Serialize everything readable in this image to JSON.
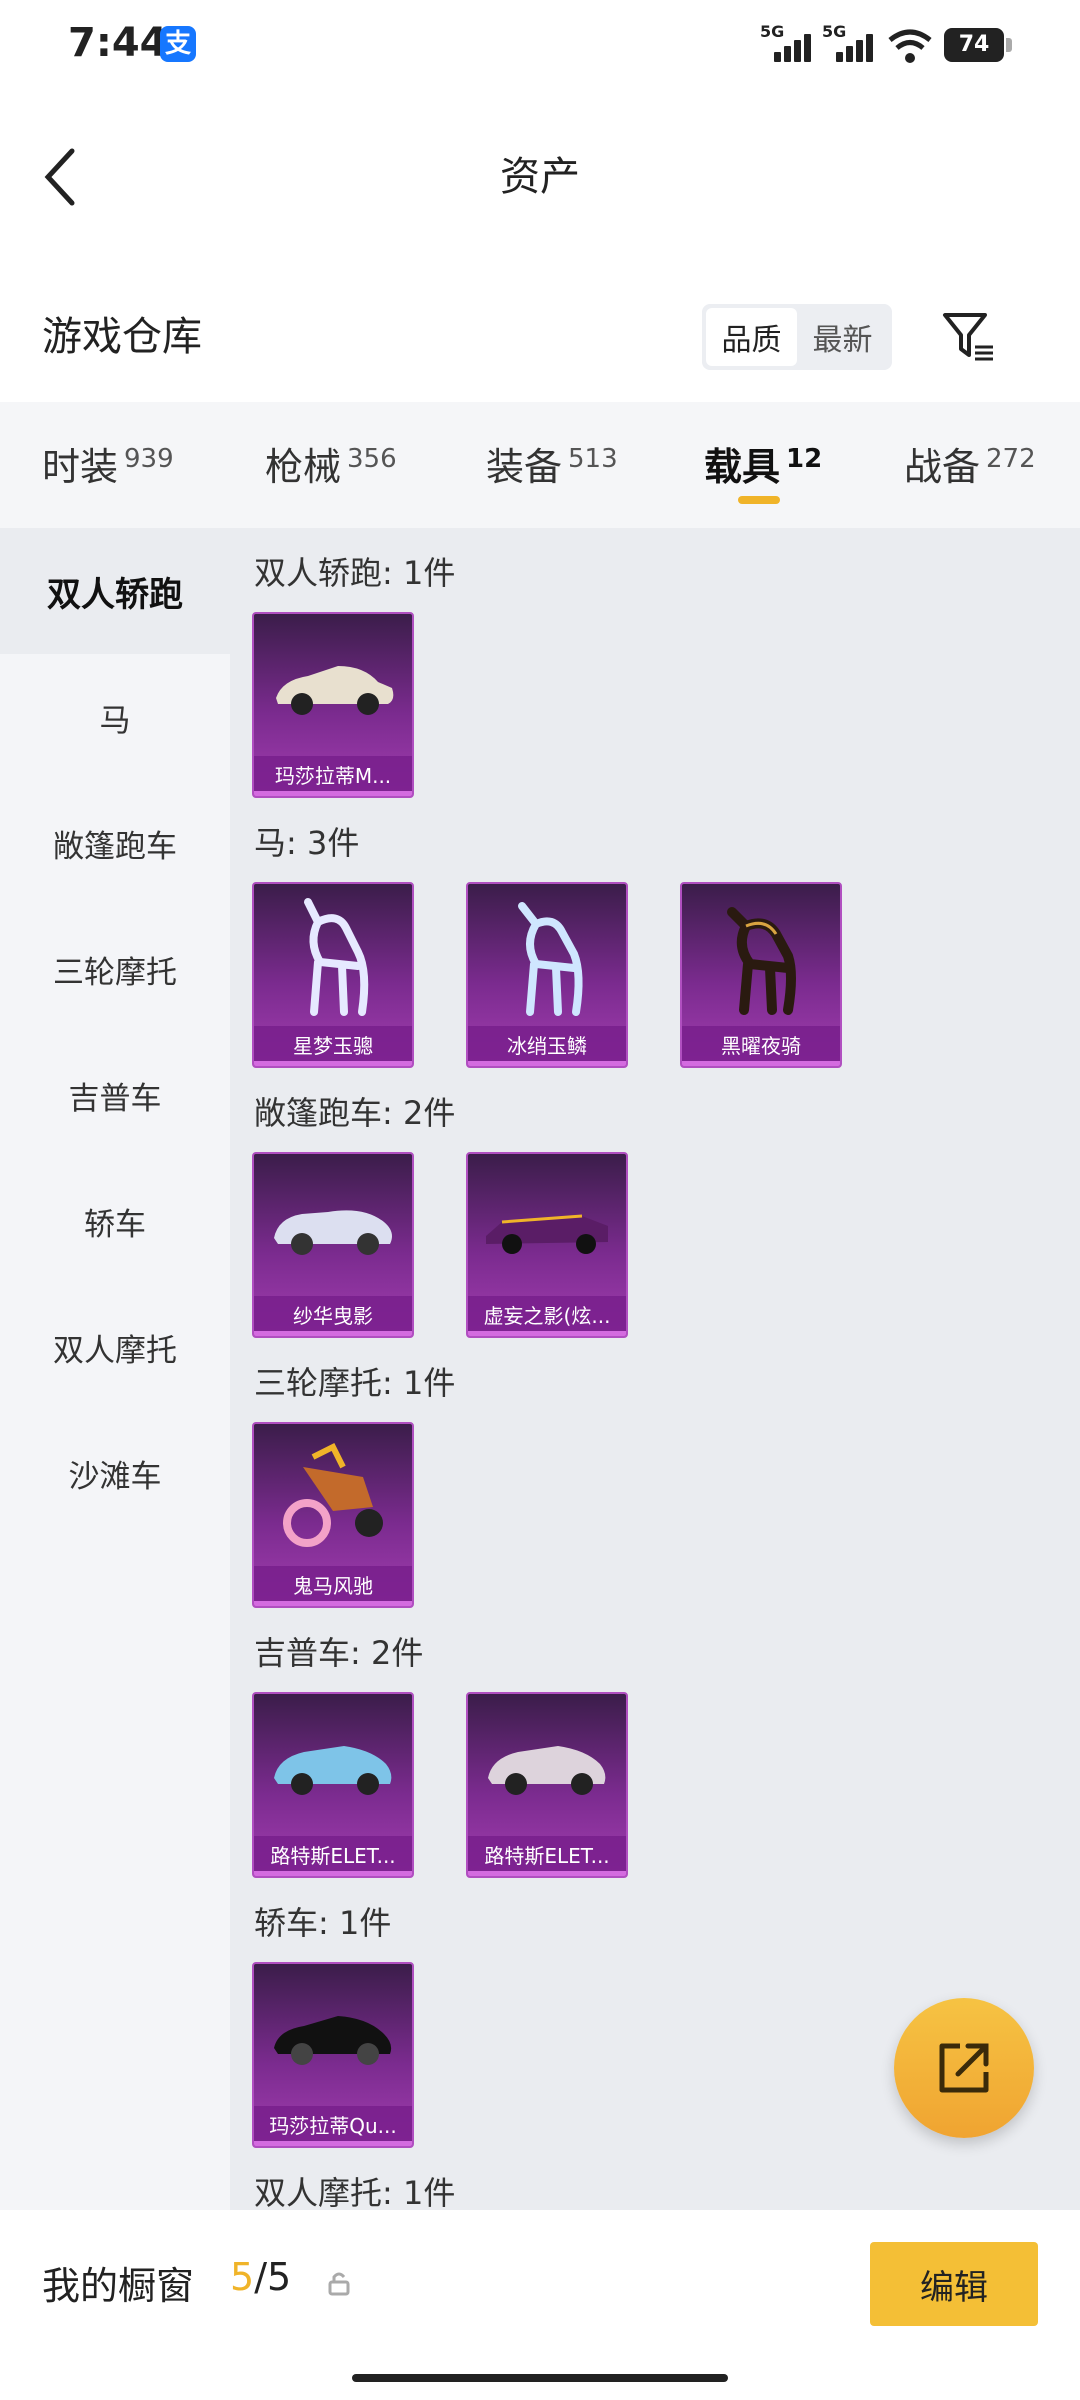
{
  "status_bar": {
    "time": "7:44",
    "alipay_icon": "支",
    "signal_1": "5G",
    "signal_2": "5G",
    "battery": "74"
  },
  "header": {
    "title": "资产"
  },
  "warehouse": {
    "title": "游戏仓库",
    "sort_quality": "品质",
    "sort_newest": "最新"
  },
  "tabs": [
    {
      "label": "时装",
      "count": "939"
    },
    {
      "label": "枪械",
      "count": "356"
    },
    {
      "label": "装备",
      "count": "513"
    },
    {
      "label": "载具",
      "count": "12"
    },
    {
      "label": "战备",
      "count": "272"
    }
  ],
  "sidebar": [
    "双人轿跑",
    "马",
    "敞篷跑车",
    "三轮摩托",
    "吉普车",
    "轿车",
    "双人摩托",
    "沙滩车"
  ],
  "groups": [
    {
      "title": "双人轿跑: 1件",
      "items": [
        "玛莎拉蒂M..."
      ]
    },
    {
      "title": "马: 3件",
      "items": [
        "星梦玉骢",
        "冰绡玉鳞",
        "黑曜夜骑"
      ]
    },
    {
      "title": "敞篷跑车: 2件",
      "items": [
        "纱华曳影",
        "虚妄之影(炫..."
      ]
    },
    {
      "title": "三轮摩托: 1件",
      "items": [
        "鬼马风驰"
      ]
    },
    {
      "title": "吉普车: 2件",
      "items": [
        "路特斯ELET...",
        "路特斯ELET..."
      ]
    },
    {
      "title": "轿车: 1件",
      "items": [
        "玛莎拉蒂Qu..."
      ]
    },
    {
      "title": "双人摩托: 1件",
      "items": []
    }
  ],
  "bottom": {
    "label": "我的橱窗",
    "current": "5",
    "total": "/5",
    "edit": "编辑"
  },
  "colors": {
    "accent": "#f4bf36",
    "card_purple": "#7b2b8f"
  }
}
